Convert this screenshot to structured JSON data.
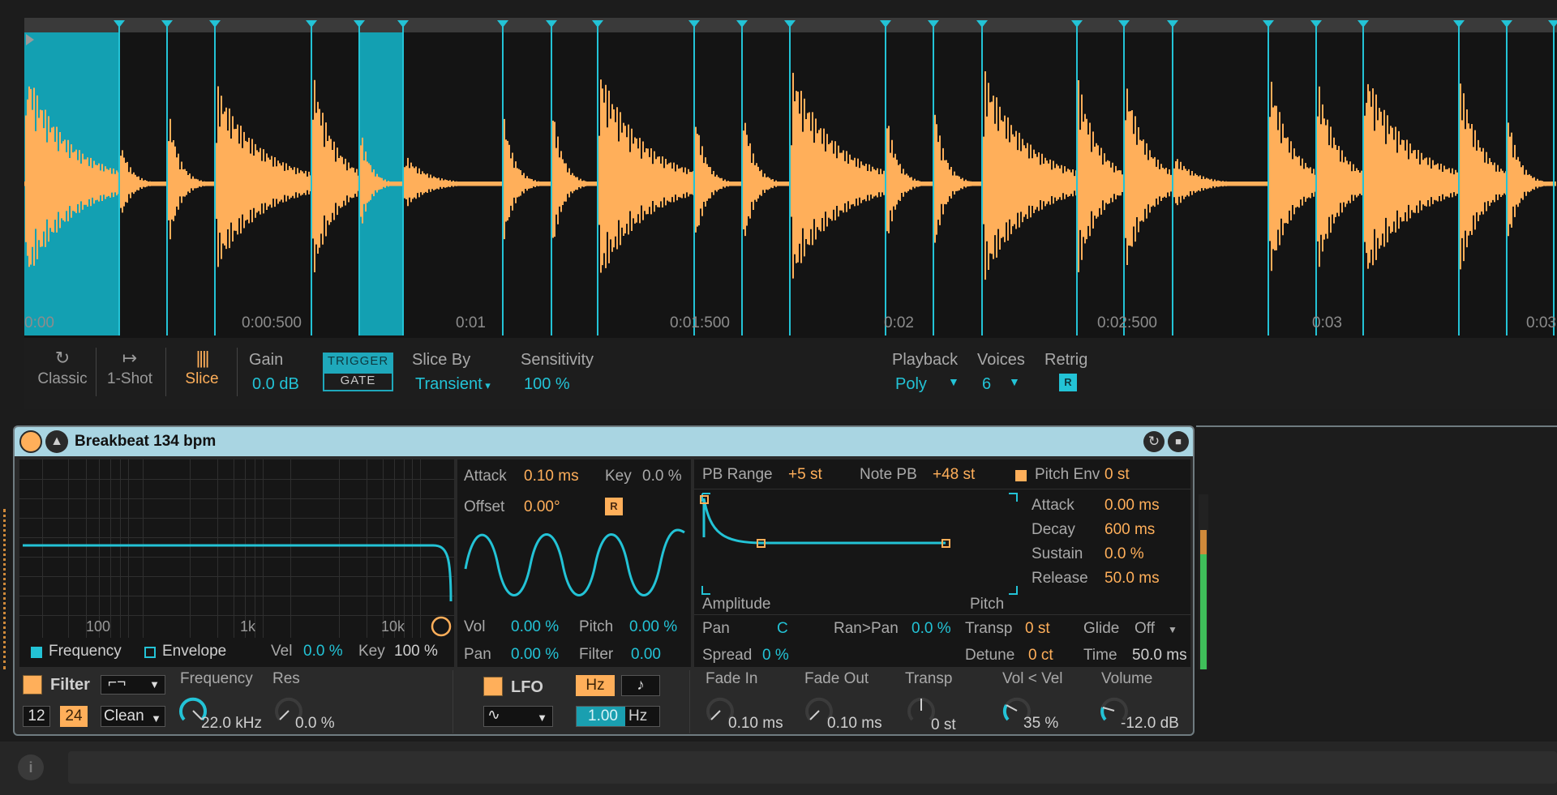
{
  "waveform": {
    "time_labels": [
      "0:00",
      "0:00:500",
      "0:01",
      "0:01:500",
      "0:02",
      "0:02:500",
      "0:03",
      "0:03"
    ],
    "slice_count": 30,
    "colors": {
      "wave": "#ffaf5a",
      "slice": "#23c3d6",
      "selected": "#13a0b2"
    }
  },
  "sampler": {
    "modes": [
      {
        "label": "Classic",
        "icon": "loop-icon"
      },
      {
        "label": "1-Shot",
        "icon": "one-shot-icon"
      },
      {
        "label": "Slice",
        "icon": "slice-icon"
      }
    ],
    "gain": {
      "label": "Gain",
      "value": "0.0 dB"
    },
    "trigger_label": "TRIGGER",
    "gate_label": "GATE",
    "slice_by": {
      "label": "Slice By",
      "value": "Transient"
    },
    "sensitivity": {
      "label": "Sensitivity",
      "value": "100 %"
    },
    "playback": {
      "label": "Playback",
      "value": "Poly"
    },
    "voices": {
      "label": "Voices",
      "value": "6"
    },
    "retrig": {
      "label": "Retrig",
      "value": "R"
    }
  },
  "device": {
    "title": "Breakbeat 134 bpm",
    "filter_display": {
      "freq_labels": [
        "100",
        "1k",
        "10k"
      ],
      "frequency_label": "Frequency",
      "envelope_label": "Envelope",
      "vel_label": "Vel",
      "vel_value": "0.0 %",
      "key_label": "Key",
      "key_value": "100 %"
    },
    "lfo_panel": {
      "attack_label": "Attack",
      "attack_value": "0.10 ms",
      "key_label": "Key",
      "key_value": "0.0 %",
      "offset_label": "Offset",
      "offset_value": "0.00°",
      "retrig_value": "R",
      "vol_label": "Vol",
      "vol_value": "0.00 %",
      "pitch_label": "Pitch",
      "pitch_value": "0.00 %",
      "pan_label": "Pan",
      "pan_value": "0.00 %",
      "filter_label": "Filter",
      "filter_value": "0.00"
    },
    "env_panel": {
      "pb_range_label": "PB Range",
      "pb_range_value": "+5 st",
      "note_pb_label": "Note PB",
      "note_pb_value": "+48 st",
      "pitch_env_label": "Pitch Env",
      "pitch_env_value": "0 st",
      "attack_label": "Attack",
      "attack_value": "0.00 ms",
      "decay_label": "Decay",
      "decay_value": "600 ms",
      "sustain_label": "Sustain",
      "sustain_value": "0.0 %",
      "release_label": "Release",
      "release_value": "50.0 ms",
      "amplitude_label": "Amplitude",
      "pitch_label": "Pitch",
      "pan_label": "Pan",
      "pan_value": "C",
      "ran_pan_label": "Ran>Pan",
      "ran_pan_value": "0.0 %",
      "spread_label": "Spread",
      "spread_value": "0 %",
      "transp_label": "Transp",
      "transp_value": "0 st",
      "detune_label": "Detune",
      "detune_value": "0 ct",
      "glide_label": "Glide",
      "glide_value": "Off",
      "time_label": "Time",
      "time_value": "50.0 ms"
    },
    "bottom": {
      "filter_label": "Filter",
      "slope_12": "12",
      "slope_24": "24",
      "circuit": "Clean",
      "frequency_label": "Frequency",
      "frequency_value": "22.0 kHz",
      "res_label": "Res",
      "res_value": "0.0 %",
      "lfo_label": "LFO",
      "hz_label": "Hz",
      "note_label": "♪",
      "rate_value": "1.00",
      "rate_unit": "Hz",
      "fade_in_label": "Fade In",
      "fade_in_value": "0.10 ms",
      "fade_out_label": "Fade Out",
      "fade_out_value": "0.10 ms",
      "transp_label": "Transp",
      "transp_value": "0 st",
      "vol_vel_label": "Vol < Vel",
      "vol_vel_value": "35 %",
      "volume_label": "Volume",
      "volume_value": "-12.0 dB"
    }
  },
  "info": {
    "icon": "info-icon"
  }
}
